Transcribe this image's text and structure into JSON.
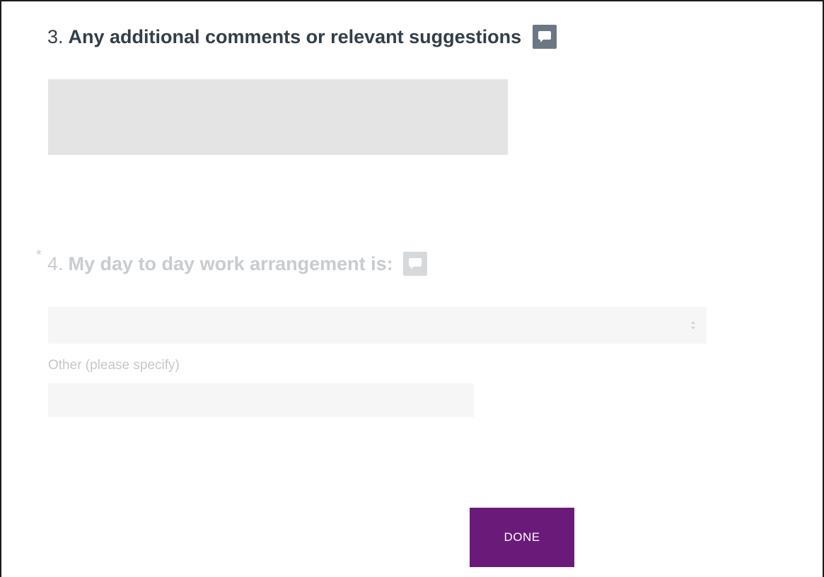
{
  "colors": {
    "heading_active": "#333e48",
    "heading_inactive": "#c8ccd0",
    "comment_icon_active": "#6b7782",
    "comment_icon_inactive": "#d5d9dc",
    "textarea_bg": "#e4e4e4",
    "inactive_field_bg": "#f6f6f6",
    "done_button_bg": "#6a1b7a",
    "done_button_text": "#ffffff"
  },
  "question3": {
    "number": "3.",
    "title": "Any additional comments or relevant suggestions",
    "comment_icon": "comment-icon",
    "textarea_value": ""
  },
  "question4": {
    "required_mark": "*",
    "number": "4.",
    "title": "My day to day work arrangement is:",
    "comment_icon": "comment-icon",
    "selected_value": "",
    "other_label": "Other (please specify)",
    "other_value": ""
  },
  "footer": {
    "done_label": "DONE"
  }
}
